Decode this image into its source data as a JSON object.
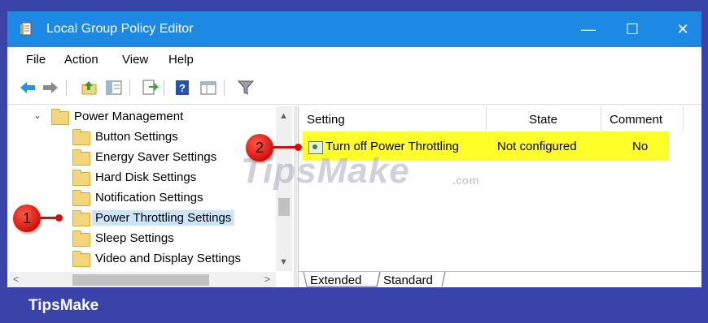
{
  "window": {
    "title": "Local Group Policy Editor",
    "minimize": "—",
    "maximize": "☐",
    "close": "✕"
  },
  "menu": {
    "items": [
      "File",
      "Action",
      "View",
      "Help"
    ]
  },
  "toolbar": {
    "icons": [
      "back-arrow-icon",
      "forward-arrow-icon",
      "up-folder-icon",
      "show-hide-tree-icon",
      "export-list-icon",
      "help-icon",
      "extended-view-icon",
      "filter-icon"
    ]
  },
  "tree": {
    "parent": {
      "label": "Power Management",
      "expanded": true
    },
    "children": [
      {
        "label": "Button Settings"
      },
      {
        "label": "Energy Saver Settings"
      },
      {
        "label": "Hard Disk Settings"
      },
      {
        "label": "Notification Settings"
      },
      {
        "label": "Power Throttling Settings",
        "selected": true
      },
      {
        "label": "Sleep Settings"
      },
      {
        "label": "Video and Display Settings"
      }
    ]
  },
  "list": {
    "columns": [
      "Setting",
      "State",
      "Comment"
    ],
    "rows": [
      {
        "setting": "Turn off Power Throttling",
        "state": "Not configured",
        "comment": "No"
      }
    ]
  },
  "tabs": [
    "Extended",
    "Standard"
  ],
  "annotations": {
    "badge1": "1",
    "badge2": "2"
  },
  "watermark": {
    "text": "TipsMake",
    "suffix": ".com"
  },
  "footer": {
    "brand": "TipsMake"
  },
  "colors": {
    "titlebar": "#1e88e5",
    "highlight": "#ffff29",
    "badge": "#d0110a",
    "footer": "#3a43a8"
  }
}
